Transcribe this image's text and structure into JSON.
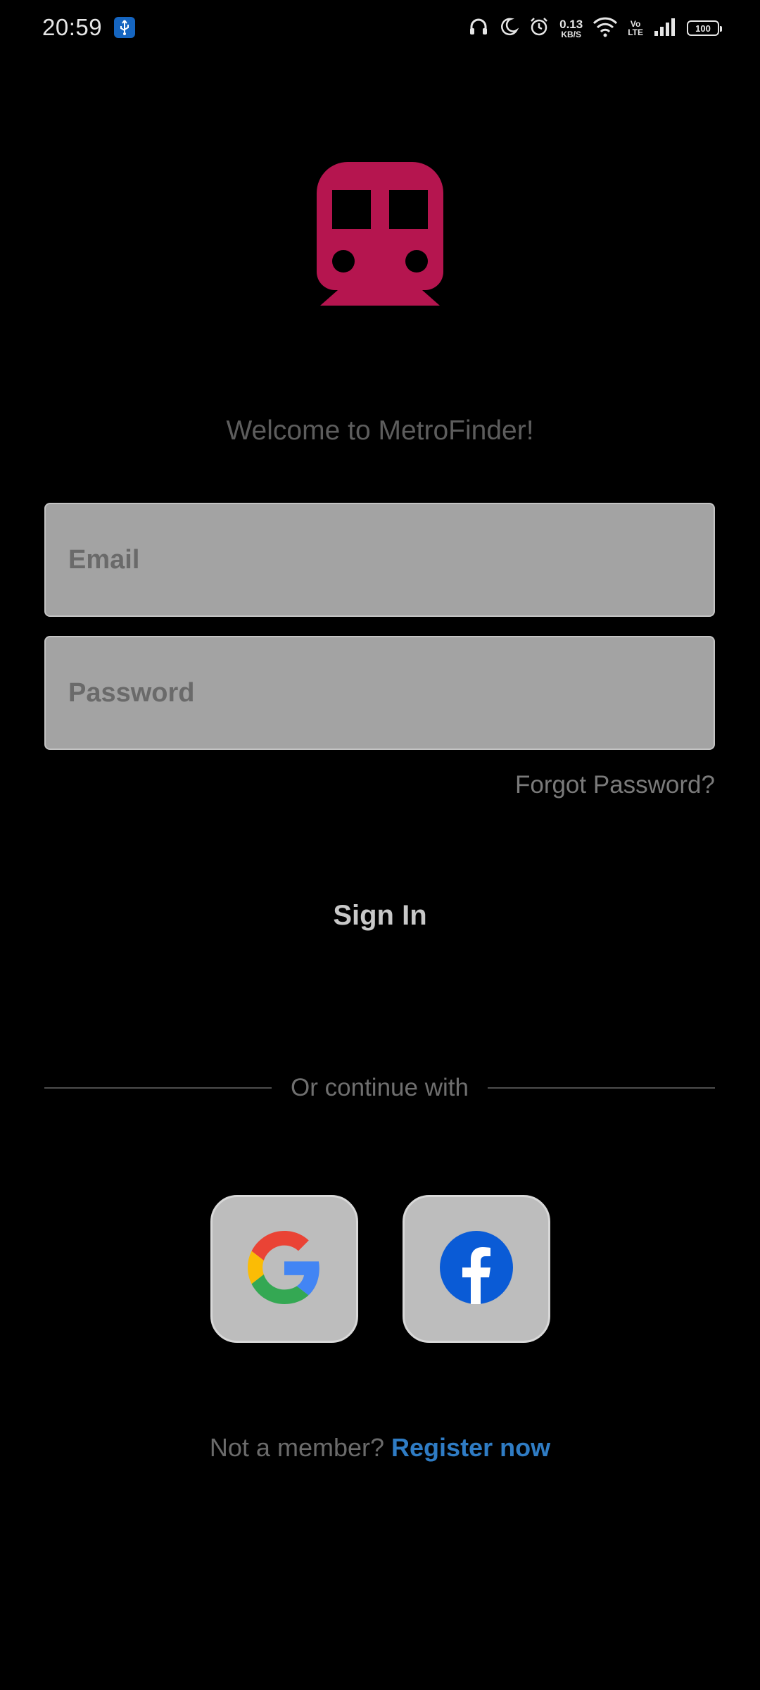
{
  "status_bar": {
    "time": "20:59",
    "usb_icon": "usb-debug-icon",
    "net_speed_value": "0.13",
    "net_speed_unit": "KB/S",
    "volte_top": "Vo",
    "volte_bottom": "LTE",
    "battery_level": "100",
    "icons": [
      "headphones-icon",
      "moon-icon",
      "alarm-icon",
      "wifi-icon",
      "signal-icon",
      "battery-icon"
    ]
  },
  "app": {
    "logo_icon": "metro-train-icon",
    "logo_color": "#b5154f",
    "welcome_text": "Welcome to MetroFinder!"
  },
  "form": {
    "email_placeholder": "Email",
    "email_value": "",
    "password_placeholder": "Password",
    "password_value": "",
    "forgot_password": "Forgot Password?",
    "sign_in": "Sign In"
  },
  "social": {
    "divider_text": "Or continue with",
    "google_icon": "google-icon",
    "facebook_icon": "facebook-icon",
    "facebook_color": "#0a5bd6"
  },
  "register": {
    "prompt": "Not a member?",
    "link": "Register now"
  }
}
